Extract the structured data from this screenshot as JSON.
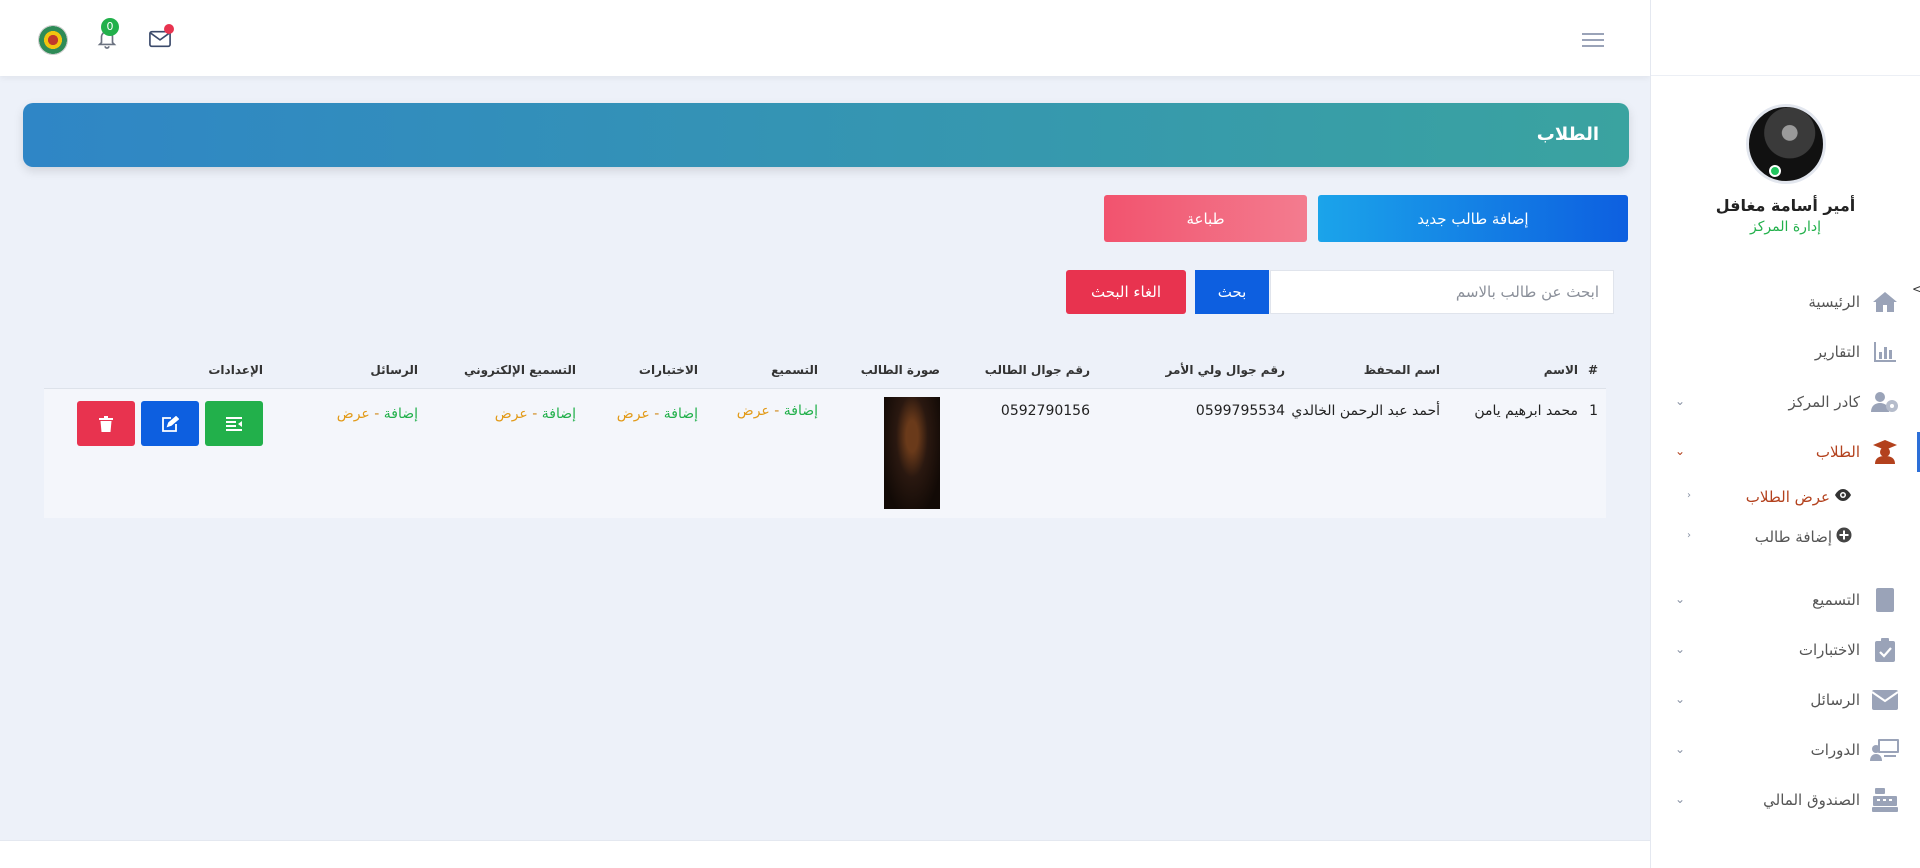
{
  "sidebar": {
    "profile": {
      "name": "أمير أسامة مغافل",
      "role": "إدارة المركز"
    },
    "collapse_glyph": "<",
    "menu": [
      {
        "label": "الرئيسية",
        "icon": "home-icon"
      },
      {
        "label": "التقارير",
        "icon": "chart-icon"
      },
      {
        "label": "كادر المركز",
        "icon": "users-icon",
        "has_submenu": true
      },
      {
        "label": "الطلاب",
        "icon": "graduate-icon",
        "has_submenu": true,
        "active": true,
        "submenu": [
          {
            "label": "عرض الطلاب",
            "icon": "eye-icon",
            "current": true
          },
          {
            "label": "إضافة طالب",
            "icon": "plus-circle-icon"
          }
        ]
      },
      {
        "label": "التسميع",
        "icon": "quran-icon",
        "has_submenu": true
      },
      {
        "label": "الاختبارات",
        "icon": "clipboard-icon",
        "has_submenu": true
      },
      {
        "label": "الرسائل",
        "icon": "envelope-icon",
        "has_submenu": true
      },
      {
        "label": "الدورات",
        "icon": "classroom-icon",
        "has_submenu": true
      },
      {
        "label": "الصندوق المالي",
        "icon": "cash-register-icon",
        "has_submenu": true
      }
    ]
  },
  "topbar": {
    "notifications_count": "0"
  },
  "page": {
    "title": "الطلاب",
    "add_button": "إضافة طالب جديد",
    "print_button": "طباعة",
    "search": {
      "placeholder": "ابحث عن طالب بالاسم",
      "value": "",
      "button": "بحث",
      "cancel": "الغاء البحث"
    }
  },
  "table": {
    "headers": [
      "#",
      "الاسم",
      "اسم المحفظ",
      "رقم جوال ولي الأمر",
      "رقم جوال الطالب",
      "صورة الطالب",
      "التسميع",
      "الاختبارات",
      "التسميع الإلكتروني",
      "الرسائل",
      "الإعدادات"
    ],
    "rows": [
      {
        "index": "1",
        "name": "محمد ابرهيم يامن",
        "teacher": "أحمد عبد الرحمن الخالدي",
        "parent_phone": "0599795534",
        "student_phone": "0592790156",
        "links": {
          "add": "إضافة",
          "sep": " - ",
          "view": "عرض"
        }
      }
    ]
  },
  "colors": {
    "primary": "#0d5fe0",
    "danger": "#e8334f",
    "success": "#22b04b",
    "header_from": "#2f86c6",
    "header_to": "#3aa3a0",
    "active_menu": "#b3411d"
  }
}
